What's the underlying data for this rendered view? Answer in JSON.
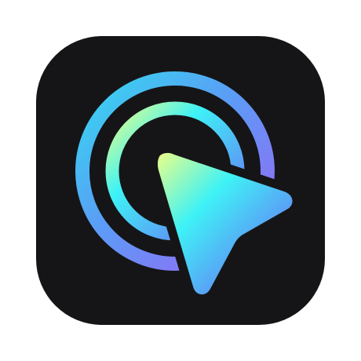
{
  "app_icon": {
    "name": "cursor-target-app-icon",
    "background_color": "#151517",
    "page_background": "#ffffff",
    "gradient_colors": {
      "yellow": "#eaff88",
      "cyan": "#3ef2f6",
      "teal": "#35d9f0",
      "blue": "#5b9cf6",
      "violet": "#9b63f4",
      "purple": "#b24ff0"
    },
    "icons": [
      "target-rings-icon",
      "cursor-arrow-icon"
    ]
  }
}
